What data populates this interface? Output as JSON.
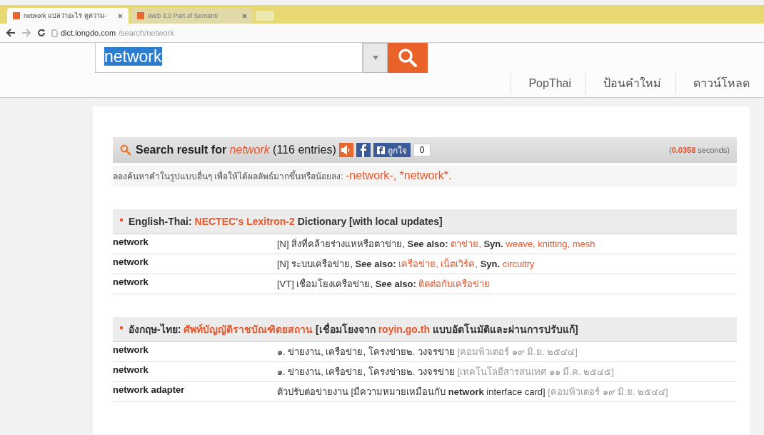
{
  "browser": {
    "tabs": [
      {
        "title": "network แปลว่าอะไร ดูความ-",
        "selected": true
      },
      {
        "title": "Web 3.0 Part of Semanti",
        "selected": false
      }
    ],
    "url_host": "dict.longdo.com",
    "url_path": "/search/network"
  },
  "search": {
    "value": "network"
  },
  "nav": [
    "PopThai",
    "ป้อนคำใหม่",
    "ดาวน์โหลด"
  ],
  "result_header": {
    "label": "Search result for",
    "query": "network",
    "count": "(116 entries)",
    "like_label": "ถูกใจ",
    "like_count": "0",
    "time_value": "0.0358",
    "time_unit": "seconds",
    "time_open": "(",
    "time_close": ")"
  },
  "hint": {
    "text": "ลองค้นหาคำในรูปแบบอื่นๆ เพื่อให้ได้ผลลัพธ์มากขึ้นหรือน้อยลง:",
    "alternatives": "-network-, *network*."
  },
  "sections": [
    {
      "prefix": "English-Thai:",
      "source": "NECTEC's Lexitron-2",
      "suffix": "Dictionary [with local updates]",
      "rows": [
        {
          "term": "network",
          "parts": [
            {
              "kind": "text",
              "text": "[N] สิ่งที่คล้ายร่างแหหรือตาข่าย,"
            },
            {
              "kind": "bold",
              "text": "See also:"
            },
            {
              "kind": "link",
              "text": "ตาข่าย,"
            },
            {
              "kind": "bold",
              "text": "Syn."
            },
            {
              "kind": "link",
              "text": "weave, knitting, mesh"
            }
          ]
        },
        {
          "term": "network",
          "parts": [
            {
              "kind": "text",
              "text": "[N] ระบบเครือข่าย,"
            },
            {
              "kind": "bold",
              "text": "See also:"
            },
            {
              "kind": "link",
              "text": "เครือข่าย, เน็ตเวิร์ค,"
            },
            {
              "kind": "bold",
              "text": "Syn."
            },
            {
              "kind": "link",
              "text": "circuitry"
            }
          ]
        },
        {
          "term": "network",
          "parts": [
            {
              "kind": "text",
              "text": "[VT] เชื่อมโยงเครือข่าย,"
            },
            {
              "kind": "bold",
              "text": "See also:"
            },
            {
              "kind": "link",
              "text": "ติดต่อกับเครือข่าย"
            }
          ]
        }
      ]
    },
    {
      "prefix": "อังกฤษ-ไทย:",
      "source": "ศัพท์บัญญัติราชบัณฑิตยสถาน",
      "suffix": "[เชื่อมโยงจาก **royin.go.th** แบบอัตโนมัติและผ่านการปรับแก้]",
      "rows": [
        {
          "term": "network",
          "parts": [
            {
              "kind": "text",
              "text": "๑. ข่ายงาน, เครือข่าย, โครงข่าย๒. วงจรข่าย"
            },
            {
              "kind": "note",
              "text": "[คอมพิวเตอร์ ๑๙ มิ.ย. ๒๕๔๔]"
            }
          ]
        },
        {
          "term": "network",
          "parts": [
            {
              "kind": "text",
              "text": "๑. ข่ายงาน, เครือข่าย, โครงข่าย๒. วงจรข่าย"
            },
            {
              "kind": "note",
              "text": "[เทคโนโลยีสารสนเทศ ๑๑ มี.ค. ๒๕๔๕]"
            }
          ]
        },
        {
          "term": "network adapter",
          "parts": [
            {
              "kind": "text",
              "text": "ตัวปรับต่อข่ายงาน [มีความหมายเหมือนกับ **network** interface card]"
            },
            {
              "kind": "note",
              "text": "[คอมพิวเตอร์ ๑๙ มิ.ย. ๒๕๔๔]"
            }
          ]
        }
      ]
    }
  ]
}
